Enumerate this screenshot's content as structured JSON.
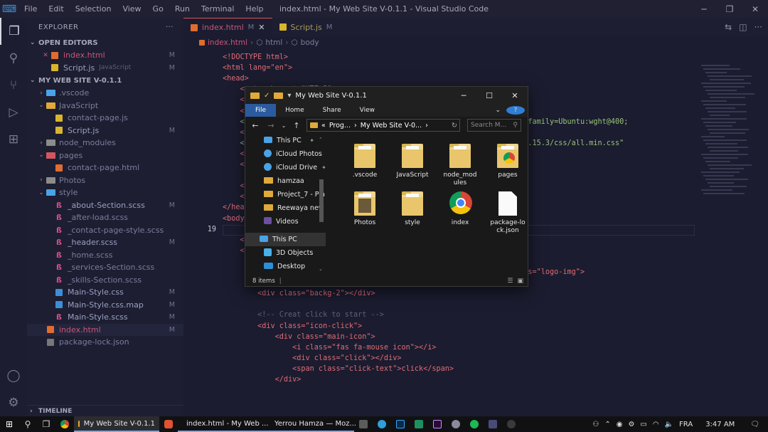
{
  "titlebar": {
    "menus": [
      "File",
      "Edit",
      "Selection",
      "View",
      "Go",
      "Run",
      "Terminal",
      "Help"
    ],
    "title": "index.html - My Web Site V-0.1.1 - Visual Studio Code",
    "min_icon": "minimize-icon",
    "restore_icon": "restore-icon",
    "close_icon": "close-icon"
  },
  "activity": [
    "files-icon",
    "search-icon",
    "source-control-icon",
    "run-debug-icon",
    "extensions-icon"
  ],
  "activity_bottom": [
    "account-icon",
    "settings-gear-icon"
  ],
  "explorer": {
    "title": "EXPLORER",
    "more": "···",
    "open_editors_label": "OPEN EDITORS",
    "open_editors": [
      {
        "close": "✕",
        "name": "index.html",
        "badge": "M"
      },
      {
        "name": "Script.js",
        "desc": "JavaScript",
        "badge": "M"
      }
    ],
    "project_label": "MY WEB SITE V-0.1.1",
    "tree": [
      {
        "name": ".vscode",
        "type": "folder"
      },
      {
        "name": "JavaScript",
        "type": "folder-open"
      },
      {
        "name": "contact-page.js",
        "type": "js"
      },
      {
        "name": "Script.js",
        "type": "js",
        "badge": "M"
      },
      {
        "name": "node_modules",
        "type": "folder"
      },
      {
        "name": "pages",
        "type": "folder-open"
      },
      {
        "name": "contact-page.html",
        "type": "html"
      },
      {
        "name": "Photos",
        "type": "folder"
      },
      {
        "name": "style",
        "type": "folder-open"
      },
      {
        "name": "_about-Section.scss",
        "type": "scss",
        "badge": "M"
      },
      {
        "name": "_after-load.scss",
        "type": "scss"
      },
      {
        "name": "_contact-page-style.scss",
        "type": "scss"
      },
      {
        "name": "_header.scss",
        "type": "scss",
        "badge": "M"
      },
      {
        "name": "_home.scss",
        "type": "scss"
      },
      {
        "name": "_services-Section.scss",
        "type": "scss"
      },
      {
        "name": "_skills-Section.scss",
        "type": "scss"
      },
      {
        "name": "Main-Style.css",
        "type": "css",
        "badge": "M"
      },
      {
        "name": "Main-Style.css.map",
        "type": "css",
        "badge": "M"
      },
      {
        "name": "Main-Style.scss",
        "type": "scss",
        "badge": "M"
      },
      {
        "name": "index.html",
        "type": "html",
        "badge": "M"
      },
      {
        "name": "package-lock.json",
        "type": "json"
      }
    ],
    "timeline_label": "TIMELINE"
  },
  "tabs": [
    {
      "name": "index.html",
      "badge": "M",
      "close": "✕"
    },
    {
      "name": "Script.js",
      "badge": "M"
    }
  ],
  "breadcrumb": [
    "index.html",
    "html",
    "body"
  ],
  "code": [
    {
      "n": "",
      "text": "<!DOCTYPE html>"
    },
    {
      "n": "",
      "text": "<html lang=\"en\">"
    },
    {
      "n": "",
      "text": "<head>"
    },
    {
      "n": "",
      "text": "    <meta charset=\"UTF-8\">"
    },
    {
      "n": "",
      "text": "    <meta                                             0\">"
    },
    {
      "n": "",
      "text": "    <link"
    },
    {
      "n": "",
      "text": "    <link                                              00;500;600;700&family=Ubuntu:wght@400;"
    },
    {
      "n": "",
      "text": "    <link"
    },
    {
      "n": "",
      "text": "    <link                                              /font-awesome/5.15.3/css/all.min.css\""
    },
    {
      "n": "",
      "text": "    <link"
    },
    {
      "n": "",
      "text": "    <link"
    },
    {
      "n": "",
      "text": ""
    },
    {
      "n": "",
      "text": "    <title"
    },
    {
      "n": "",
      "text": "    <link"
    },
    {
      "n": "",
      "text": "</head>"
    },
    {
      "n": "",
      "text": "<body>"
    },
    {
      "n": "19",
      "text": ""
    },
    {
      "n": "",
      "text": "    <!--"
    },
    {
      "n": "",
      "text": "    <div"
    },
    {
      "n": "",
      "text": "        <div class=\"logo\">"
    },
    {
      "n": "",
      "text": "            <img src=\"/Photos/Logo-4.png\" alt=\"Yerrou Hamza Logo\" class=\"logo-img\">"
    },
    {
      "n": "",
      "text": "        </div>"
    },
    {
      "n": "",
      "text": "        <div class=\"backg-2\"></div>"
    },
    {
      "n": "",
      "text": ""
    },
    {
      "n": "",
      "text": "        <!-- Creat click to start -->"
    },
    {
      "n": "",
      "text": "        <div class=\"icon-click\">"
    },
    {
      "n": "",
      "text": "            <div class=\"main-icon\">"
    },
    {
      "n": "",
      "text": "                <i class=\"fas fa-mouse icon\"></i>"
    },
    {
      "n": "",
      "text": "                <div class=\"click\"></div>"
    },
    {
      "n": "",
      "text": "                <span class=\"click-text\">click</span>"
    },
    {
      "n": "",
      "text": "            </div>"
    }
  ],
  "file_explorer": {
    "title": "My Web Site V-0.1.1",
    "ribbon": [
      "File",
      "Home",
      "Share",
      "View"
    ],
    "path": [
      "«",
      "Prog...",
      "›",
      "My Web Site V-0...",
      "›"
    ],
    "search_placeholder": "Search M...",
    "nav_pane": [
      {
        "name": "This PC",
        "pin": "📌",
        "icon": "pc"
      },
      {
        "name": "iCloud Photos",
        "pin": "📌",
        "icon": "icloud"
      },
      {
        "name": "iCloud Drive",
        "pin": "📌",
        "icon": "icloud"
      },
      {
        "name": "hamzaa",
        "icon": "folder"
      },
      {
        "name": "Project_7 - Pla",
        "icon": "folder"
      },
      {
        "name": "Reewaya new",
        "icon": "folder"
      },
      {
        "name": "Videos",
        "icon": "video"
      },
      {
        "name": "This PC",
        "icon": "pc",
        "sel": true
      },
      {
        "name": "3D Objects",
        "icon": "cube"
      },
      {
        "name": "Desktop",
        "icon": "desktop"
      }
    ],
    "items": [
      {
        "name": ".vscode",
        "kind": "folder"
      },
      {
        "name": "JavaScript",
        "kind": "folder"
      },
      {
        "name": "node_mod ules",
        "kind": "folder"
      },
      {
        "name": "pages",
        "kind": "chrome-folder"
      },
      {
        "name": "Photos",
        "kind": "photo-folder"
      },
      {
        "name": "style",
        "kind": "folder"
      },
      {
        "name": "index",
        "kind": "chrome"
      },
      {
        "name": "package-lo ck.json",
        "kind": "doc"
      }
    ],
    "status": "8 items"
  },
  "taskbar": {
    "apps": [
      {
        "name": "My Web Site V-0.1.1",
        "icon": "folder-icon",
        "active": true
      },
      {
        "name": "index.html - My Web ...",
        "icon": "vscode-icon"
      },
      {
        "name": "Yerrou Hamza — Moz...",
        "icon": "firefox-icon"
      }
    ],
    "lang": "FRA",
    "time": "3:47 AM"
  },
  "colors": {
    "accent": "#3b8fd9",
    "tab_active_border": "#d2565f",
    "explorer_bg": "#191919",
    "ribbon_file": "#2b5b9e"
  }
}
